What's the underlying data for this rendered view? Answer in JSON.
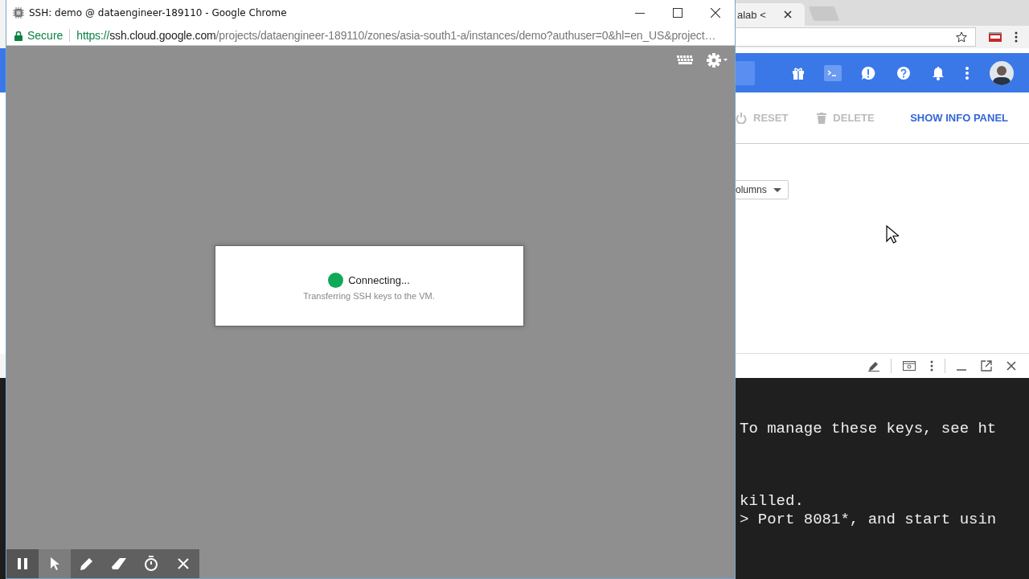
{
  "ssh_window": {
    "title": "SSH: demo @ dataengineer-189110 - Google Chrome",
    "security_label": "Secure",
    "url": {
      "scheme": "https://",
      "host": "ssh.cloud.google.com",
      "path": "/projects/dataengineer-189110/zones/asia-south1-a/instances/demo?authuser=0&hl=en_US&project…"
    },
    "dialog": {
      "status": "Connecting...",
      "message": "Transferring SSH keys to the VM."
    }
  },
  "recorder_toolbar": {
    "tools": [
      {
        "kind": "pause",
        "selected": false
      },
      {
        "kind": "pointer",
        "selected": true
      },
      {
        "kind": "pen",
        "selected": false
      },
      {
        "kind": "eraser",
        "selected": false
      },
      {
        "kind": "timer",
        "selected": false
      },
      {
        "kind": "close",
        "selected": false
      }
    ]
  },
  "back_browser": {
    "tabs": [
      {
        "label": "alab <"
      }
    ],
    "header_icons": [
      {
        "kind": "gift",
        "selected": false
      },
      {
        "kind": "shell",
        "selected": true
      },
      {
        "kind": "feedback",
        "selected": false
      },
      {
        "kind": "help",
        "selected": false
      },
      {
        "kind": "bell",
        "selected": false
      },
      {
        "kind": "more",
        "selected": false
      },
      {
        "kind": "avatar",
        "selected": false
      }
    ],
    "actions": [
      {
        "kind": "reset",
        "label": "RESET",
        "disabled": true
      },
      {
        "kind": "delete",
        "label": "DELETE",
        "disabled": true
      },
      {
        "kind": "info",
        "label": "SHOW INFO PANEL",
        "disabled": false
      }
    ],
    "columns_button": {
      "label": "olumns"
    },
    "terminal": {
      "blocks": [
        [
          "To manage these keys, see ht"
        ],
        [
          "killed.",
          "> Port 8081*, and start usin"
        ]
      ]
    }
  }
}
